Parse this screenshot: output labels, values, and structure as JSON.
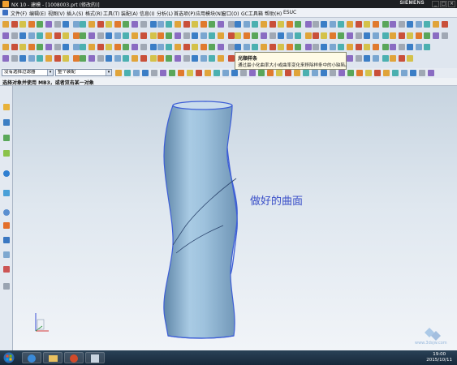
{
  "titlebar": {
    "title": "NX 10 - 建模 - [1008003.prt (修改的)]",
    "brand": "SIEMENS"
  },
  "menubar": {
    "items": [
      "文件(F)",
      "编辑(E)",
      "视图(V)",
      "插入(S)",
      "格式(R)",
      "工具(T)",
      "装配(A)",
      "信息(I)",
      "分析(L)",
      "首选项(P)",
      "应用模块(N)",
      "窗口(O)",
      "GC工具箱",
      "帮助(H)",
      "ESUC"
    ]
  },
  "selection_bar": {
    "type_filter": "没有选择过滤器",
    "scope": "整个装配"
  },
  "cue_line": "选择对象并使用 MB3，或者双击某一对象",
  "tooltip": {
    "title": "光顺样条",
    "description": "通过最小化曲率大小或曲率变化来移除样条中的小缺陷。"
  },
  "viewport": {
    "annotation": "做好的曲面"
  },
  "taskbar": {
    "time": "19:00",
    "date": "2015/10/11"
  },
  "watermark": "www.3dsjw.com",
  "colors": {
    "accent": "#3a4fc8",
    "surface": "#9cc0dc",
    "surface_dark": "#6b92b5"
  }
}
